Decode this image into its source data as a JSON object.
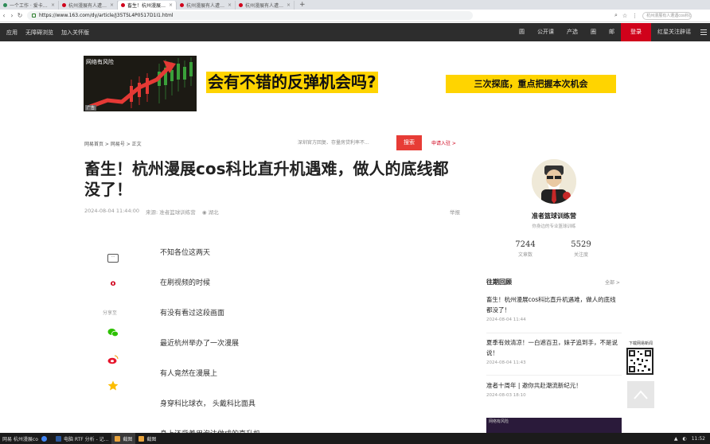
{
  "browser": {
    "tabs": [
      {
        "label": "一个工作 · 爱卡说网"
      },
      {
        "label": "杭州漫展有人遭遇cos飞机遇险"
      },
      {
        "label": "畜生！杭州漫展cos科比直升机"
      },
      {
        "label": "杭州漫展有人遭遇cos科比直升机"
      },
      {
        "label": "杭州漫展有人遭遇cos科比直升机"
      }
    ],
    "new_tab": "+",
    "url": "https://www.163.com/dy/article/J35T5L4P0517D1I1.html",
    "search_placeholder": "杭州漫展有人遭遇cos科比..."
  },
  "site_nav": {
    "left": [
      "应用",
      "无障碍浏览",
      "加入关怀版"
    ],
    "right": [
      "圆",
      "公开课",
      "产选",
      "圈",
      "邮",
      "登录",
      "红星关注辟谣"
    ]
  },
  "ad": {
    "risk_label": "网络有风险",
    "ad_tag": "广告",
    "headline": "会有不错的反弹机会吗?",
    "sub": "三次探底，重点把握本次机会"
  },
  "breadcrumb": "网易首页 > 网易号 > 正文",
  "search": {
    "placeholder": "深圳官方回复、存量房贷利率不...",
    "button": "搜索",
    "join": "申请入驻 >"
  },
  "article": {
    "title": "畜生！杭州漫展cos科比直升机遇难，做人的底线都没了！",
    "date": "2024-08-04 11:44:00",
    "source": "来源: 准者篮球训练营",
    "location": "湖北",
    "report": "举报",
    "paragraphs": [
      "不知各位这两天",
      "在刷视频的时候",
      "有没有看过这段画面",
      "最近杭州举办了一次漫展",
      "有人竟然在漫展上",
      "身穿科比球衣， 头戴科比面具",
      "身上还背着用泡沫做成的直升机"
    ]
  },
  "share": {
    "comment_icon": "···",
    "label": "分享至"
  },
  "author": {
    "name": "准者篮球训练营",
    "desc": "你身边的专业篮球训练",
    "articles_value": "7244",
    "articles_label": "文章数",
    "followers_value": "5529",
    "followers_label": "关注度"
  },
  "recent": {
    "heading": "往期回顾",
    "all": "全部 >",
    "items": [
      {
        "title": "畜生！杭州漫展cos科比直升机遇难，做人的底线都没了！",
        "date": "2024-08-04 11:44"
      },
      {
        "title": "夏季有效清凉！一白遮百丑，妹子追到手，不是说说！",
        "date": "2024-08-04 11:43"
      },
      {
        "title": "准者十周年 | 邀你共赴潮流新纪元！",
        "date": "2024-08-03 18:10"
      }
    ],
    "ad_label": "网络有风险"
  },
  "floating": {
    "qr_label": "下载网易新闻"
  },
  "taskbar": {
    "start": "网易 杭州漫展cos...",
    "tasks": [
      "",
      "电脑 RTF 分析 - 记...",
      "截图",
      "截图"
    ],
    "clock": "11:52"
  },
  "colors": {
    "brand_red": "#d0021b",
    "search_red": "#e73c36",
    "ad_yellow": "#ffd400",
    "nav_dark": "#2d2d2d"
  }
}
